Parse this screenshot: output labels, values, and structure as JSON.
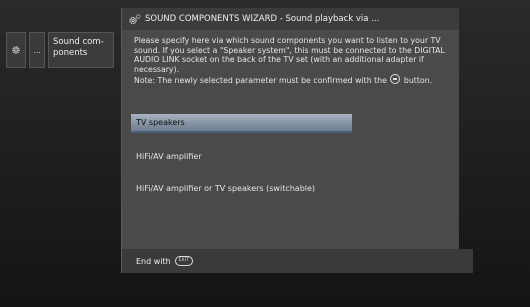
{
  "breadcrumb": {
    "ellipsis": "...",
    "current": "Sound com-\nponents"
  },
  "wizard": {
    "title": "SOUND COMPONENTS WIZARD - Sound playback via ...",
    "description": "Please specify here via which sound components you want to listen to your TV sound. If you select a \"Speaker system\", this must be connected to the DIGITAL AUDIO LINK socket on the back of the TV set (with an additional adapter if necessary).",
    "note_before": "Note: The newly selected parameter must be confirmed with the",
    "note_after": "button.",
    "ok_key_icon": "ok-button-icon",
    "options": [
      {
        "label": "TV speakers",
        "selected": true
      },
      {
        "label": "HiFi/AV amplifier",
        "selected": false
      },
      {
        "label": "HiFi/AV amplifier or TV speakers (switchable)",
        "selected": false
      }
    ],
    "footer_label": "End with",
    "footer_key": "EXIT"
  }
}
